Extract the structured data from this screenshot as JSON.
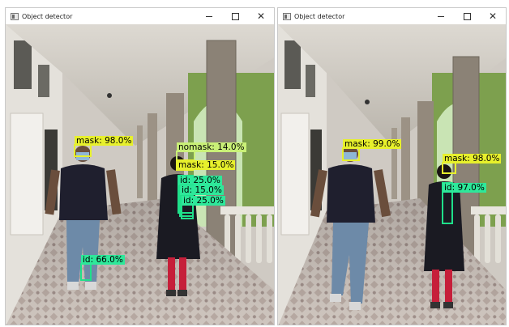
{
  "windows": [
    {
      "title": "Object detector",
      "icon": "app-window-icon",
      "detections": [
        {
          "kind": "mask",
          "label": "mask: 98.0%"
        },
        {
          "kind": "nomask",
          "label": "nomask: 14.0%"
        },
        {
          "kind": "mask",
          "label": "mask: 15.0%"
        },
        {
          "kind": "id",
          "label": "id: 25.0%"
        },
        {
          "kind": "id",
          "label": "id: 15.0%"
        },
        {
          "kind": "id",
          "label": "id: 25.0%"
        },
        {
          "kind": "id",
          "label": "id: 66.0%"
        }
      ]
    },
    {
      "title": "Object detector",
      "icon": "app-window-icon",
      "detections": [
        {
          "kind": "mask",
          "label": "mask: 99.0%"
        },
        {
          "kind": "mask",
          "label": "mask: 98.0%"
        },
        {
          "kind": "id",
          "label": "id: 97.0%"
        }
      ]
    }
  ],
  "colors": {
    "mask_box": "#e7f02c",
    "nomask_box": "#c9f077",
    "id_box": "#1fe08a"
  }
}
